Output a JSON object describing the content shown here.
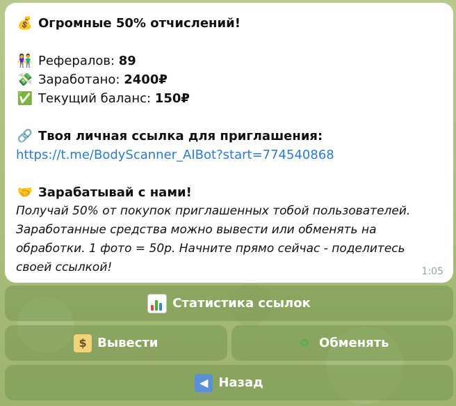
{
  "message": {
    "title": "Огромные 50% отчислений!",
    "title_icon": "💰",
    "referrals_icon": "👫",
    "referrals_label": "Рефералов:",
    "referrals_value": "89",
    "earned_icon": "💸",
    "earned_label": "Заработано:",
    "earned_value": "2400₽",
    "balance_icon": "✅",
    "balance_label": "Текущий баланс:",
    "balance_value": "150₽",
    "link_heading_icon": "🔗",
    "link_heading": "Твоя личная ссылка для приглашения:",
    "invite_link": "https://t.me/BodyScanner_AIBot?start=774540868",
    "earn_heading_icon": "🤝",
    "earn_heading": "Зарабатывай с нами!",
    "earn_text": "Получай 50% от покупок приглашенных тобой пользователей. Заработанные средства можно вывести или обменять на обработки. 1 фото = 50р. Начните прямо сейчас - поделитесь своей ссылкой!",
    "time": "1:05"
  },
  "keyboard": {
    "stats_label": "Статистика ссылок",
    "withdraw_label": "Вывести",
    "exchange_label": "Обменять",
    "back_label": "Назад",
    "money_icon_glyph": "$",
    "recycle_icon_glyph": "♻",
    "back_icon_glyph": "◀"
  },
  "colors": {
    "link": "#2b7bd1",
    "button_bg": "#7f9650",
    "chat_bg": "#a9c17f",
    "stat_bar_red": "#e0463b",
    "stat_bar_green": "#3fae49",
    "stat_bar_blue": "#3f7fd9"
  }
}
